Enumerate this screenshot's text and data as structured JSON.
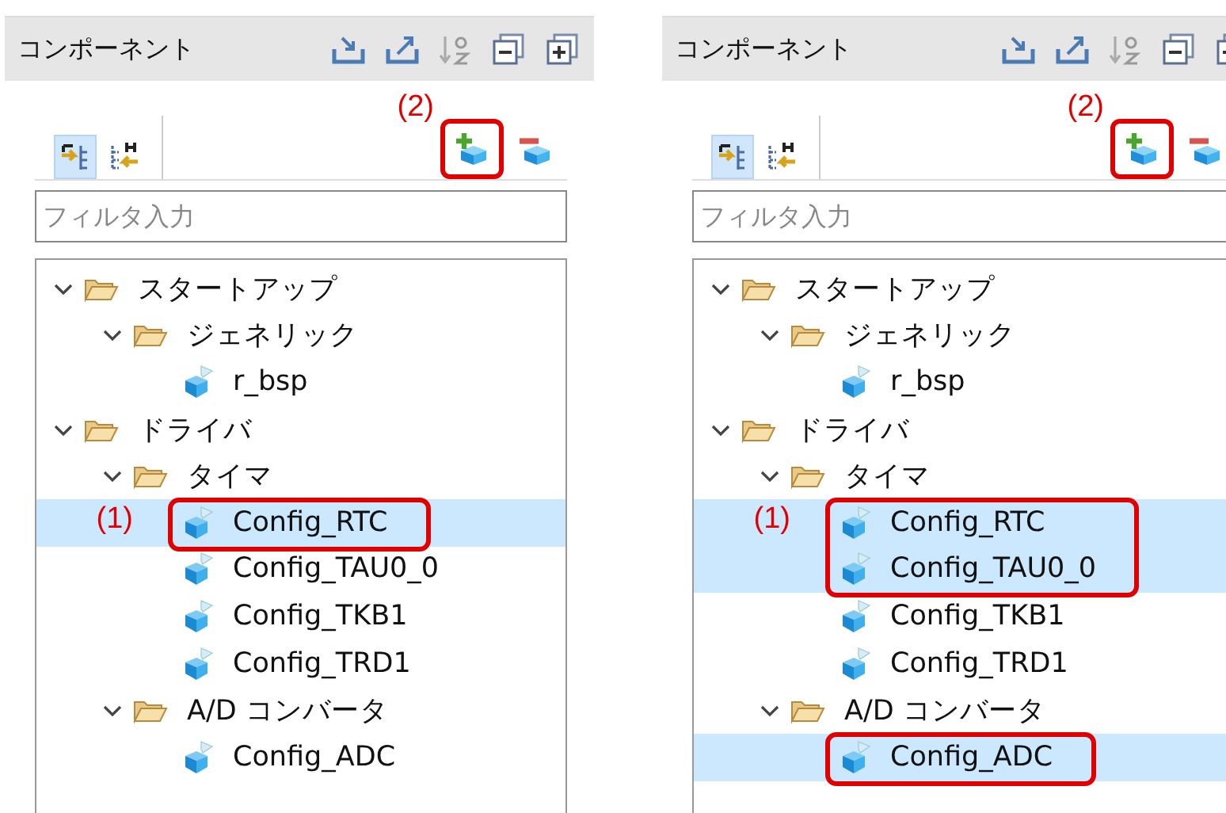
{
  "panels": [
    {
      "title": "コンポーネント",
      "view_toggles": [
        {
          "selected": true
        },
        {
          "selected": false
        }
      ],
      "add_label": "(2)",
      "add_boxed": true,
      "filter": {
        "placeholder": "フィルタ入力"
      },
      "tree_label": "(1)",
      "tree": [
        {
          "label": "スタートアップ",
          "kind": "folder",
          "expanded": true,
          "selected": false,
          "boxed": false,
          "children": [
            {
              "label": "ジェネリック",
              "kind": "folder",
              "expanded": true,
              "selected": false,
              "boxed": false,
              "children": [
                {
                  "label": "r_bsp",
                  "kind": "component",
                  "selected": false,
                  "boxed": false
                }
              ]
            }
          ]
        },
        {
          "label": "ドライバ",
          "kind": "folder",
          "expanded": true,
          "selected": false,
          "boxed": false,
          "children": [
            {
              "label": "タイマ",
              "kind": "folder",
              "expanded": true,
              "selected": false,
              "boxed": false,
              "children": [
                {
                  "label": "Config_RTC",
                  "kind": "component",
                  "selected": true,
                  "boxed": true
                },
                {
                  "label": "Config_TAU0_0",
                  "kind": "component",
                  "selected": false,
                  "boxed": false
                },
                {
                  "label": "Config_TKB1",
                  "kind": "component",
                  "selected": false,
                  "boxed": false
                },
                {
                  "label": "Config_TRD1",
                  "kind": "component",
                  "selected": false,
                  "boxed": false
                }
              ]
            },
            {
              "label": "A/D コンバータ",
              "kind": "folder",
              "expanded": true,
              "selected": false,
              "boxed": false,
              "children": [
                {
                  "label": "Config_ADC",
                  "kind": "component",
                  "selected": false,
                  "boxed": false
                }
              ]
            }
          ]
        }
      ]
    },
    {
      "title": "コンポーネント",
      "view_toggles": [
        {
          "selected": true
        },
        {
          "selected": false
        }
      ],
      "add_label": "(2)",
      "add_boxed": true,
      "filter": {
        "placeholder": "フィルタ入力"
      },
      "tree_label": "(1)",
      "tree": [
        {
          "label": "スタートアップ",
          "kind": "folder",
          "expanded": true,
          "selected": false,
          "boxed": false,
          "children": [
            {
              "label": "ジェネリック",
              "kind": "folder",
              "expanded": true,
              "selected": false,
              "boxed": false,
              "children": [
                {
                  "label": "r_bsp",
                  "kind": "component",
                  "selected": false,
                  "boxed": false
                }
              ]
            }
          ]
        },
        {
          "label": "ドライバ",
          "kind": "folder",
          "expanded": true,
          "selected": false,
          "boxed": false,
          "children": [
            {
              "label": "タイマ",
              "kind": "folder",
              "expanded": true,
              "selected": false,
              "boxed": false,
              "children": [
                {
                  "label": "Config_RTC",
                  "kind": "component",
                  "selected": true,
                  "boxed": true
                },
                {
                  "label": "Config_TAU0_0",
                  "kind": "component",
                  "selected": true,
                  "boxed": true
                },
                {
                  "label": "Config_TKB1",
                  "kind": "component",
                  "selected": false,
                  "boxed": false
                },
                {
                  "label": "Config_TRD1",
                  "kind": "component",
                  "selected": false,
                  "boxed": false
                }
              ]
            },
            {
              "label": "A/D コンバータ",
              "kind": "folder",
              "expanded": true,
              "selected": false,
              "boxed": false,
              "children": [
                {
                  "label": "Config_ADC",
                  "kind": "component",
                  "selected": true,
                  "boxed": true
                }
              ]
            }
          ]
        }
      ]
    }
  ]
}
